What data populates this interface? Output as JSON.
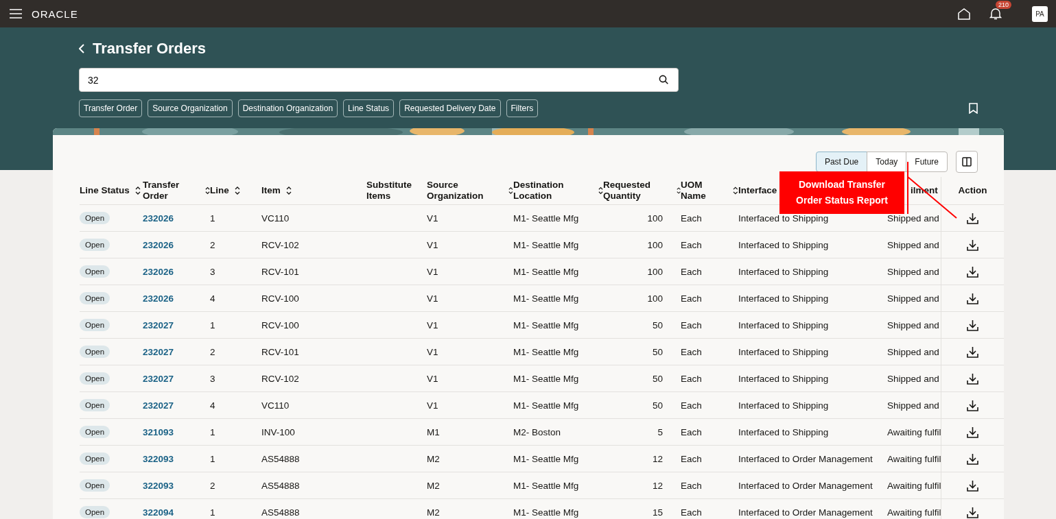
{
  "topbar": {
    "logo": "ORACLE",
    "notification_count": "210",
    "avatar": "PA"
  },
  "page": {
    "title": "Transfer Orders",
    "search": {
      "value": "32"
    },
    "filter_chips": [
      "Transfer Order",
      "Source Organization",
      "Destination Organization",
      "Line Status",
      "Requested Delivery Date",
      "Filters"
    ]
  },
  "table": {
    "date_filter": [
      {
        "label": "Past Due",
        "selected": true
      },
      {
        "label": "Today",
        "selected": false
      },
      {
        "label": "Future",
        "selected": false
      }
    ],
    "columns": [
      {
        "label": "Line Status",
        "sortable": true
      },
      {
        "label": "Transfer Order",
        "sortable": true
      },
      {
        "label": "Line",
        "sortable": true
      },
      {
        "label": "Item",
        "sortable": true
      },
      {
        "label": "Substitute Items",
        "sortable": false
      },
      {
        "label": "Source Organization",
        "sortable": true
      },
      {
        "label": "Destination Location",
        "sortable": true
      },
      {
        "label": "Requested Quantity",
        "sortable": true
      },
      {
        "label": "UOM Name",
        "sortable": true
      },
      {
        "label": "Interface",
        "sortable": false
      },
      {
        "label": "ilment",
        "sortable": false
      },
      {
        "label": "Action",
        "sortable": false
      }
    ],
    "rows": [
      {
        "cells": [
          "Open",
          "232026",
          "1",
          "VC110",
          "",
          "V1",
          "M1- Seattle Mfg",
          "100",
          "Each",
          "Interfaced to Shipping",
          "Shipped and"
        ]
      },
      {
        "cells": [
          "Open",
          "232026",
          "2",
          "RCV-102",
          "",
          "V1",
          "M1- Seattle Mfg",
          "100",
          "Each",
          "Interfaced to Shipping",
          "Shipped and"
        ]
      },
      {
        "cells": [
          "Open",
          "232026",
          "3",
          "RCV-101",
          "",
          "V1",
          "M1- Seattle Mfg",
          "100",
          "Each",
          "Interfaced to Shipping",
          "Shipped and"
        ]
      },
      {
        "cells": [
          "Open",
          "232026",
          "4",
          "RCV-100",
          "",
          "V1",
          "M1- Seattle Mfg",
          "100",
          "Each",
          "Interfaced to Shipping",
          "Shipped and"
        ]
      },
      {
        "cells": [
          "Open",
          "232027",
          "1",
          "RCV-100",
          "",
          "V1",
          "M1- Seattle Mfg",
          "50",
          "Each",
          "Interfaced to Shipping",
          "Shipped and"
        ]
      },
      {
        "cells": [
          "Open",
          "232027",
          "2",
          "RCV-101",
          "",
          "V1",
          "M1- Seattle Mfg",
          "50",
          "Each",
          "Interfaced to Shipping",
          "Shipped and"
        ]
      },
      {
        "cells": [
          "Open",
          "232027",
          "3",
          "RCV-102",
          "",
          "V1",
          "M1- Seattle Mfg",
          "50",
          "Each",
          "Interfaced to Shipping",
          "Shipped and"
        ]
      },
      {
        "cells": [
          "Open",
          "232027",
          "4",
          "VC110",
          "",
          "V1",
          "M1- Seattle Mfg",
          "50",
          "Each",
          "Interfaced to Shipping",
          "Shipped and"
        ]
      },
      {
        "cells": [
          "Open",
          "321093",
          "1",
          "INV-100",
          "",
          "M1",
          "M2- Boston",
          "5",
          "Each",
          "Interfaced to Shipping",
          "Awaiting fulfil"
        ]
      },
      {
        "cells": [
          "Open",
          "322093",
          "1",
          "AS54888",
          "",
          "M2",
          "M1- Seattle Mfg",
          "12",
          "Each",
          "Interfaced to Order Management",
          "Awaiting fulfil"
        ]
      },
      {
        "cells": [
          "Open",
          "322093",
          "2",
          "AS54888",
          "",
          "M2",
          "M1- Seattle Mfg",
          "12",
          "Each",
          "Interfaced to Order Management",
          "Awaiting fulfil"
        ]
      },
      {
        "cells": [
          "Open",
          "322094",
          "1",
          "AS54888",
          "",
          "M2",
          "M1- Seattle Mfg",
          "15",
          "Each",
          "Interfaced to Order Management",
          "Awaiting fulfil"
        ]
      }
    ]
  },
  "callout": {
    "text": "Download Transfer Order Status Report"
  }
}
